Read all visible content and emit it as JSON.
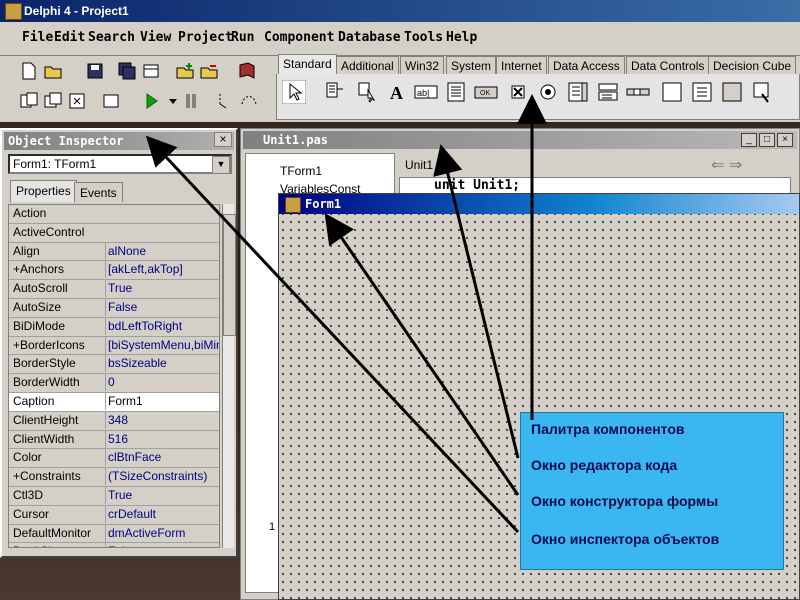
{
  "app": {
    "title": "Delphi 4 - Project1"
  },
  "menu": [
    "File",
    "Edit",
    "Search",
    "View",
    "Project",
    "Run",
    "Component",
    "Database",
    "Tools",
    "Help"
  ],
  "palette_tabs": [
    "Standard",
    "Additional",
    "Win32",
    "System",
    "Internet",
    "Data Access",
    "Data Controls",
    "Decision Cube"
  ],
  "palette_active": "Standard",
  "object_inspector": {
    "title": "Object Inspector",
    "selected_object": "Form1: TForm1",
    "tabs": [
      "Properties",
      "Events"
    ],
    "properties": [
      [
        "Action",
        ""
      ],
      [
        "ActiveControl",
        ""
      ],
      [
        "Align",
        "alNone"
      ],
      [
        "+Anchors",
        "[akLeft,akTop]"
      ],
      [
        "AutoScroll",
        "True"
      ],
      [
        "AutoSize",
        "False"
      ],
      [
        "BiDiMode",
        "bdLeftToRight"
      ],
      [
        "+BorderIcons",
        "[biSystemMenu,biMinim"
      ],
      [
        "BorderStyle",
        "bsSizeable"
      ],
      [
        "BorderWidth",
        "0"
      ],
      [
        "Caption",
        "Form1"
      ],
      [
        "ClientHeight",
        "348"
      ],
      [
        "ClientWidth",
        "516"
      ],
      [
        "Color",
        "clBtnFace"
      ],
      [
        "+Constraints",
        "(TSizeConstraints)"
      ],
      [
        "Ctl3D",
        "True"
      ],
      [
        "Cursor",
        "crDefault"
      ],
      [
        "DefaultMonitor",
        "dmActiveForm"
      ],
      [
        "DockSite",
        "False"
      ]
    ],
    "selected_property": "Caption"
  },
  "code_editor": {
    "title": "Unit1.pas",
    "tab": "Unit1",
    "tree_root": "TForm1",
    "tree_item": "VariablesConst",
    "code_first_line": "unit Unit1;",
    "status_line": "1"
  },
  "form_designer": {
    "title": "Form1"
  },
  "annotations": [
    "Палитра компонентов",
    "Окно редактора кода",
    "Окно конструктора формы",
    "Окно инспектора объектов"
  ],
  "colors": {
    "annotation_bg": "#3ab6f0",
    "title_active": "#000080",
    "arrow": "#000000"
  }
}
